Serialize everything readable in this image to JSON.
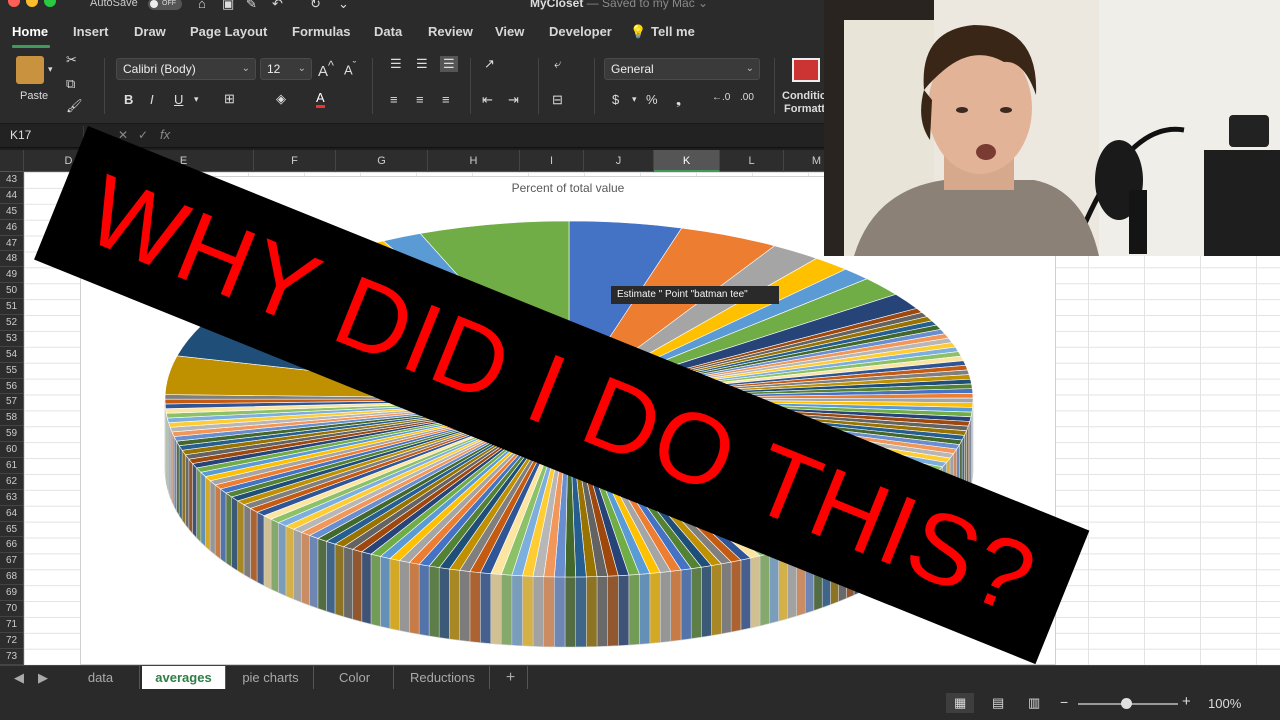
{
  "titlebar": {
    "autosave_label": "AutoSave",
    "autosave_state": "OFF",
    "doc_name": "MyCloset",
    "doc_status": " — Saved to my Mac ⌄"
  },
  "ribbon_tabs": [
    "Home",
    "Insert",
    "Draw",
    "Page Layout",
    "Formulas",
    "Data",
    "Review",
    "View",
    "Developer",
    "Tell me"
  ],
  "ribbon": {
    "paste_label": "Paste",
    "font_name": "Calibri (Body)",
    "font_size": "12",
    "number_format": "General",
    "conditional_label_1": "Conditio",
    "conditional_label_2": "Formatti"
  },
  "formula_bar": {
    "name_box": "K17",
    "fx_label": "fx",
    "formula": ""
  },
  "columns": [
    "D",
    "E",
    "F",
    "G",
    "H",
    "I",
    "J",
    "K",
    "L",
    "M"
  ],
  "selected_column": "K",
  "rows": [
    "43",
    "44",
    "45",
    "46",
    "47",
    "48",
    "49",
    "50",
    "51",
    "52",
    "53",
    "54",
    "55",
    "56",
    "57",
    "58",
    "59",
    "60",
    "61",
    "62",
    "63",
    "64",
    "65",
    "66",
    "67",
    "68",
    "69",
    "70",
    "71",
    "72",
    "73"
  ],
  "chart": {
    "title": "Percent of total value",
    "tooltip": "Estimate \" Point \"batman tee\""
  },
  "chart_data": {
    "type": "pie",
    "title": "Percent of total value",
    "variant": "3d",
    "slice_count_estimate": 150,
    "largest_slice_labels": [
      "batman tee"
    ],
    "legend": "none"
  },
  "overlay": {
    "text": "WHY DID I DO THIS?",
    "colors": {
      "background": "#000000",
      "text": "#ff0000"
    }
  },
  "sheet_tabs": [
    "data",
    "averages",
    "pie charts",
    "Color",
    "Reductions"
  ],
  "active_sheet": "averages",
  "add_sheet_label": "+",
  "status": {
    "zoom": "100%",
    "zoom_minus": "−",
    "zoom_plus": "+"
  },
  "colors": {
    "accent": "#3f9b5a",
    "ribbon_bg": "#2b2b2b"
  }
}
